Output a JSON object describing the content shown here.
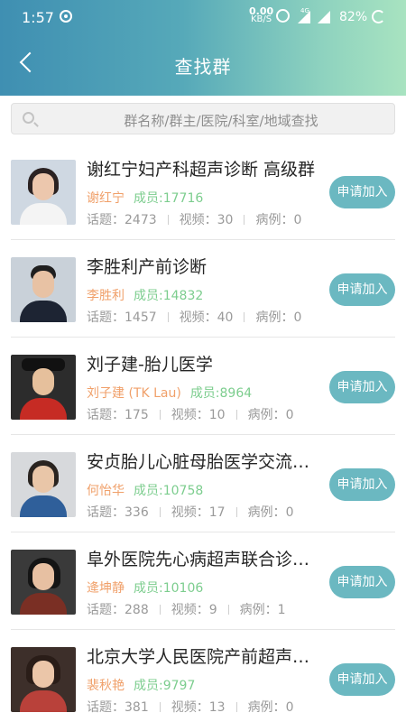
{
  "status_bar": {
    "time": "1:57",
    "net_speed": "0.00",
    "net_unit": "KB/S",
    "network": "4G",
    "battery": "82%"
  },
  "header": {
    "title": "查找群"
  },
  "search": {
    "placeholder": "群名称/群主/医院/科室/地域查找"
  },
  "labels": {
    "topics": "话题：",
    "videos": "视频：",
    "cases": "病例：",
    "join": "申请加入"
  },
  "groups": [
    {
      "name": "谢红宁妇产科超声诊断 高级群",
      "owner": "谢红宁",
      "members": "成员:17716",
      "topics": "2473",
      "videos": "30",
      "cases": "0"
    },
    {
      "name": "李胜利产前诊断",
      "owner": "李胜利",
      "members": "成员:14832",
      "topics": "1457",
      "videos": "40",
      "cases": "0"
    },
    {
      "name": "刘子建-胎儿医学",
      "owner": "刘子建 (TK Lau)",
      "members": "成员:8964",
      "topics": "175",
      "videos": "10",
      "cases": "0"
    },
    {
      "name": "安贞胎儿心脏母胎医学交流…",
      "owner": "何怡华",
      "members": "成员:10758",
      "topics": "336",
      "videos": "17",
      "cases": "0"
    },
    {
      "name": "阜外医院先心病超声联合诊…",
      "owner": "逄坤静",
      "members": "成员:10106",
      "topics": "288",
      "videos": "9",
      "cases": "1"
    },
    {
      "name": "北京大学人民医院产前超声…",
      "owner": "裴秋艳",
      "members": "成员:9797",
      "topics": "381",
      "videos": "13",
      "cases": "0"
    }
  ]
}
